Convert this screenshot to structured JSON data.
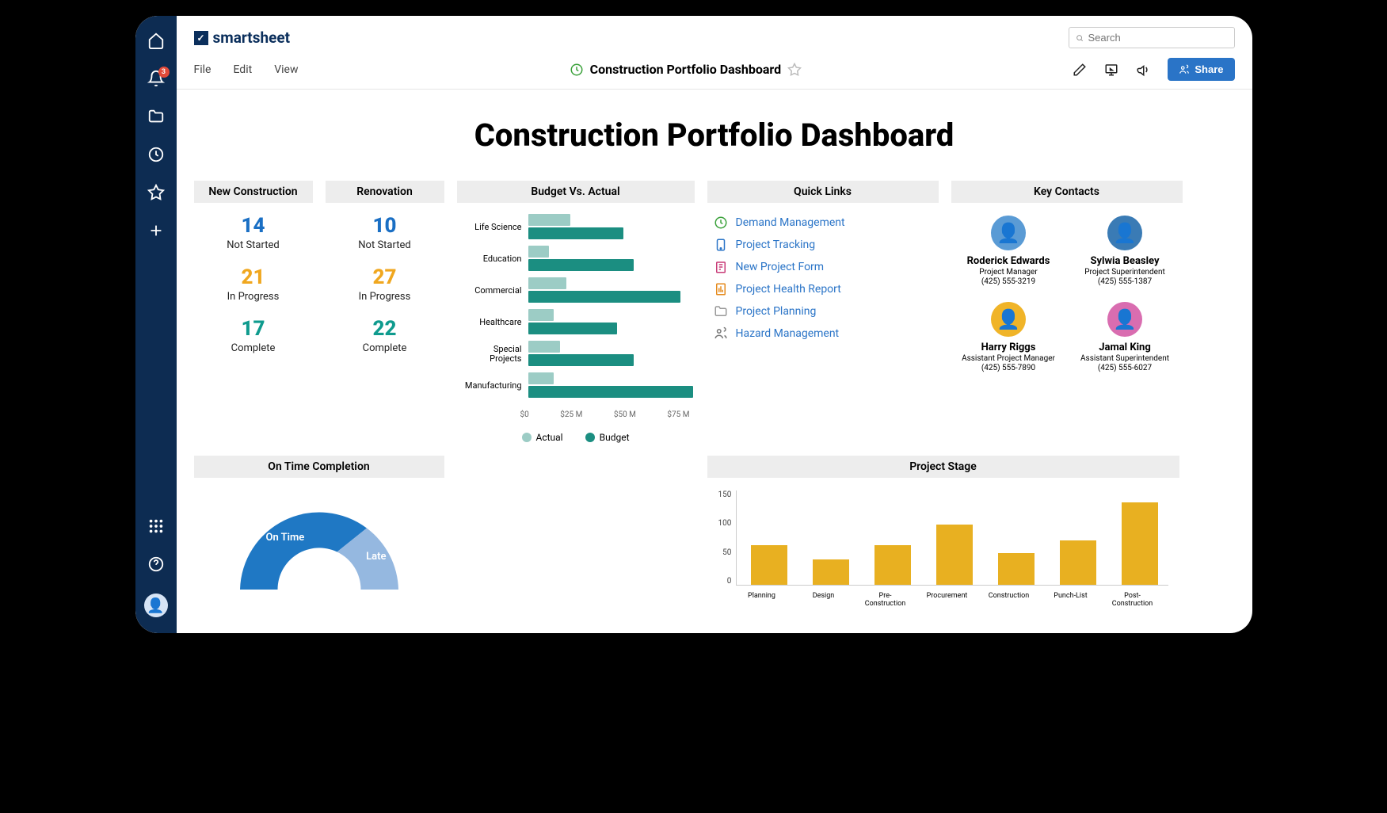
{
  "brand": "smartsheet",
  "search": {
    "placeholder": "Search"
  },
  "notifications": {
    "count": "3"
  },
  "menu": {
    "file": "File",
    "edit": "Edit",
    "view": "View"
  },
  "doc_title": "Construction Portfolio Dashboard",
  "share_label": "Share",
  "dashboard_heading": "Construction Portfolio Dashboard",
  "widgets": {
    "new_construction": {
      "title": "New Construction",
      "stats": [
        {
          "value": "14",
          "label": "Not Started",
          "color": "blue"
        },
        {
          "value": "21",
          "label": "In Progress",
          "color": "orange"
        },
        {
          "value": "17",
          "label": "Complete",
          "color": "teal"
        }
      ]
    },
    "renovation": {
      "title": "Renovation",
      "stats": [
        {
          "value": "10",
          "label": "Not Started",
          "color": "blue"
        },
        {
          "value": "27",
          "label": "In Progress",
          "color": "orange"
        },
        {
          "value": "22",
          "label": "Complete",
          "color": "teal"
        }
      ]
    },
    "budget": {
      "title": "Budget Vs. Actual",
      "legend": {
        "actual": "Actual",
        "budget": "Budget"
      },
      "axis": [
        "$0",
        "$25 M",
        "$50 M",
        "$75 M"
      ]
    },
    "quick_links": {
      "title": "Quick Links",
      "items": [
        {
          "label": "Demand Management",
          "icon": "clock",
          "color": "#3aa13a"
        },
        {
          "label": "Project Tracking",
          "icon": "tablet",
          "color": "#2a74c7"
        },
        {
          "label": "New Project Form",
          "icon": "form",
          "color": "#c83a77"
        },
        {
          "label": "Project Health Report",
          "icon": "report",
          "color": "#e58a1c"
        },
        {
          "label": "Project Planning",
          "icon": "folder",
          "color": "#999"
        },
        {
          "label": "Hazard Management",
          "icon": "people",
          "color": "#777"
        }
      ]
    },
    "key_contacts": {
      "title": "Key Contacts",
      "people": [
        {
          "name": "Roderick Edwards",
          "role": "Project Manager",
          "phone": "(425) 555-3219",
          "bg": "#5a9bd5"
        },
        {
          "name": "Sylwia Beasley",
          "role": "Project Superintendent",
          "phone": "(425) 555-1387",
          "bg": "#3a7bb5"
        },
        {
          "name": "Harry Riggs",
          "role": "Assistant Project Manager",
          "phone": "(425) 555-7890",
          "bg": "#f0b428"
        },
        {
          "name": "Jamal King",
          "role": "Assistant Superintendent",
          "phone": "(425) 555-6027",
          "bg": "#d96db0"
        }
      ]
    },
    "on_time": {
      "title": "On Time Completion",
      "segments": {
        "on_time": "On Time",
        "late": "Late"
      }
    },
    "project_stage": {
      "title": "Project Stage",
      "y_ticks": [
        "150",
        "100",
        "50",
        "0"
      ]
    }
  },
  "chart_data": [
    {
      "type": "bar",
      "title": "Budget Vs. Actual",
      "orientation": "horizontal",
      "categories": [
        "Life Science",
        "Education",
        "Commercial",
        "Healthcare",
        "Special Projects",
        "Manufacturing"
      ],
      "series": [
        {
          "name": "Actual",
          "values": [
            20,
            10,
            18,
            12,
            15,
            12
          ],
          "color": "#9cccc5"
        },
        {
          "name": "Budget",
          "values": [
            45,
            50,
            72,
            42,
            50,
            78
          ],
          "color": "#1b8e81"
        }
      ],
      "xlabel": "",
      "ylabel": "",
      "xlim": [
        0,
        75
      ],
      "x_unit": "M USD"
    },
    {
      "type": "pie",
      "title": "On Time Completion",
      "categories": [
        "On Time",
        "Late"
      ],
      "values": [
        70,
        30
      ],
      "colors": [
        "#1f78c4",
        "#95b8e0"
      ],
      "style": "half-donut"
    },
    {
      "type": "bar",
      "title": "Project Stage",
      "categories": [
        "Planning",
        "Design",
        "Pre-Construction",
        "Procurement",
        "Construction",
        "Punch-List",
        "Post-Construction"
      ],
      "values": [
        62,
        40,
        62,
        95,
        50,
        70,
        130
      ],
      "ylim": [
        0,
        150
      ],
      "color": "#e8b021"
    }
  ]
}
